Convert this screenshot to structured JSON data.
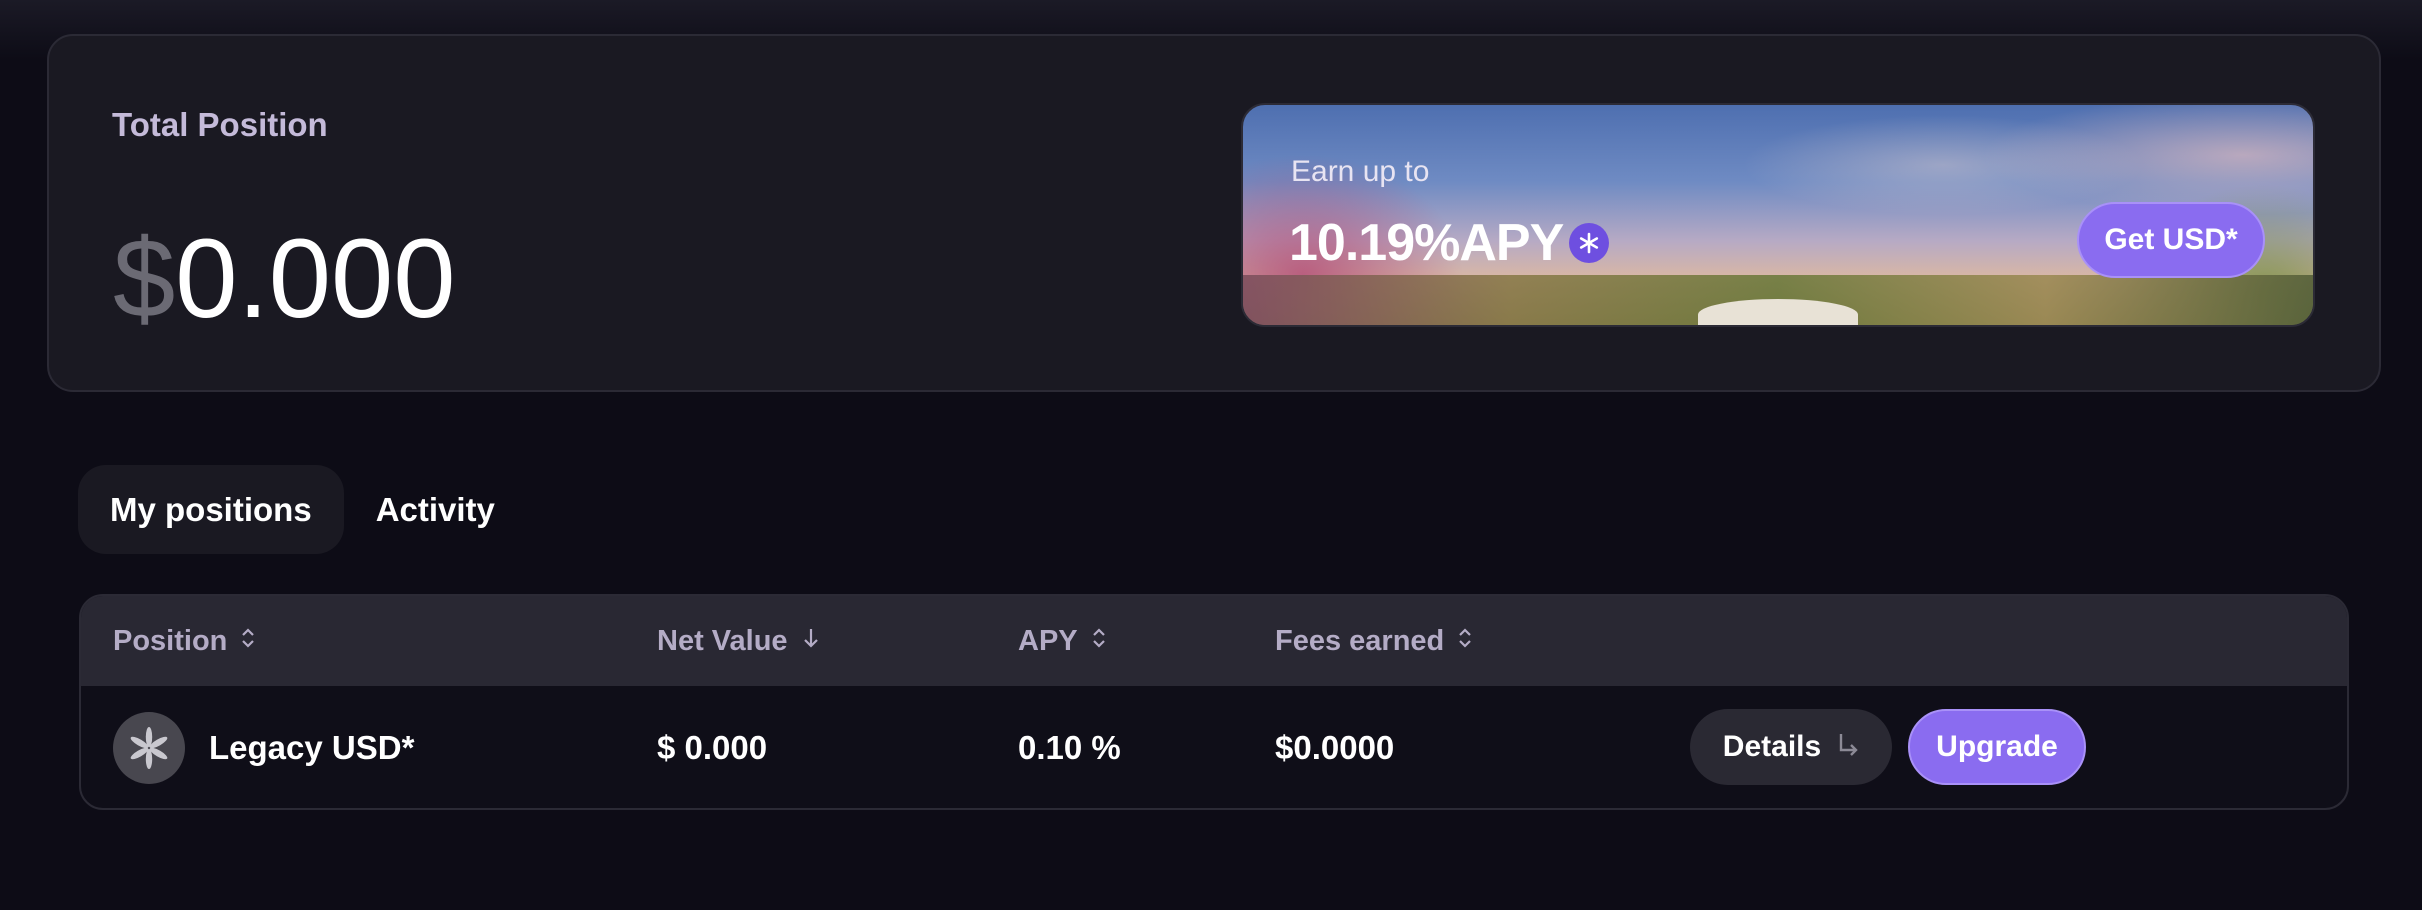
{
  "summary": {
    "label": "Total Position",
    "currency_symbol": "$",
    "amount": "0.000"
  },
  "promo": {
    "earn_label": "Earn up to",
    "rate": "10.19%APY",
    "badge_icon": "asterisk-badge-icon",
    "cta_label": "Get USD*"
  },
  "tabs": [
    {
      "label": "My positions",
      "active": true
    },
    {
      "label": "Activity",
      "active": false
    }
  ],
  "table": {
    "columns": [
      {
        "label": "Position",
        "sort_icon": "sort-both-icon"
      },
      {
        "label": "Net Value",
        "sort_icon": "sort-down-icon"
      },
      {
        "label": "APY",
        "sort_icon": "sort-both-icon"
      },
      {
        "label": "Fees earned",
        "sort_icon": "sort-both-icon"
      }
    ],
    "rows": [
      {
        "position": "Legacy USD*",
        "icon": "legacy-usd-asterisk-icon",
        "net_value": "$ 0.000",
        "apy": "0.10 %",
        "fees": "$0.0000",
        "details_label": "Details",
        "details_icon": "arrow-return-icon",
        "upgrade_label": "Upgrade"
      }
    ]
  },
  "colors": {
    "accent": "#8a6cf0",
    "background": "#0d0c16",
    "card": "#1a1922"
  }
}
